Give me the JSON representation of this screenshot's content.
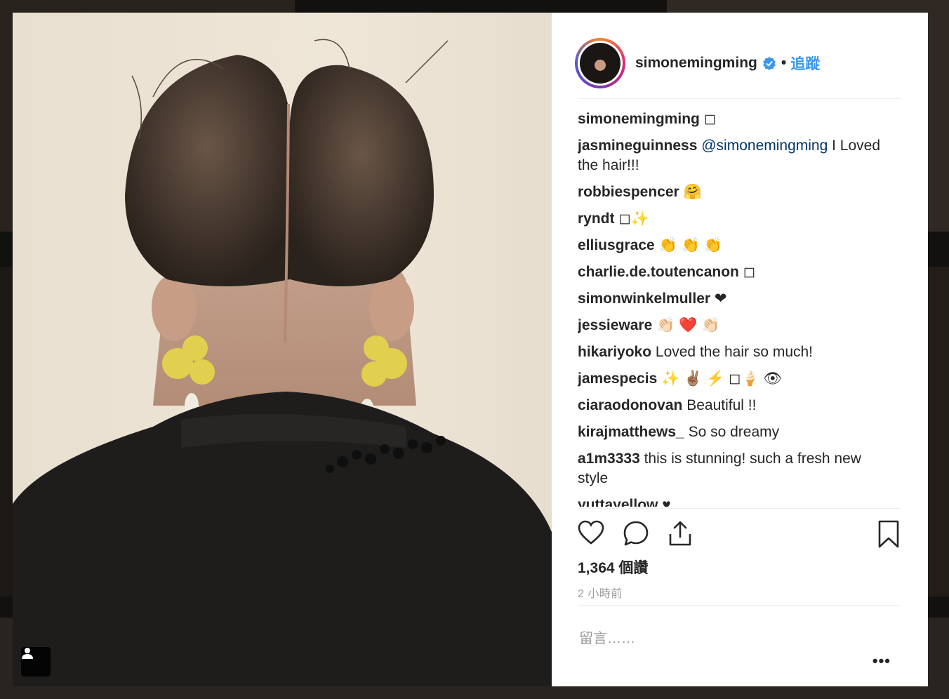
{
  "post": {
    "username": "simonemingming",
    "dot": "•",
    "follow_label": "追蹤",
    "caption_symbol": "◻"
  },
  "comments": [
    {
      "user": "simonemingming",
      "text": "◻"
    },
    {
      "user": "jasmineguinness",
      "mention": "@simonemingming",
      "text": " I Loved the hair!!!"
    },
    {
      "user": "robbiespencer",
      "text": "🤗"
    },
    {
      "user": "ryndt",
      "text": "◻✨"
    },
    {
      "user": "elliusgrace",
      "text": "👏 👏 👏"
    },
    {
      "user": "charlie.de.toutencanon",
      "text": "◻"
    },
    {
      "user": "simonwinkelmuller",
      "text": "❤"
    },
    {
      "user": "jessieware",
      "text": "👏🏻 ❤️ 👏🏻"
    },
    {
      "user": "hikariyoko",
      "text": "Loved the hair so much!"
    },
    {
      "user": "jamespecis",
      "text": "✨ ✌🏽 ⚡ ◻🍦 👁"
    },
    {
      "user": "ciaraodonovan",
      "text": "Beautiful !!"
    },
    {
      "user": "kirajmatthews_",
      "text": "So so dreamy"
    },
    {
      "user": "a1m3333",
      "text": "this is stunning! such a fresh new style"
    },
    {
      "user": "yuttayellow",
      "text": "♥"
    }
  ],
  "likes": "1,364 個讚",
  "time": "2 小時前",
  "comment_placeholder": "留言……",
  "more": "•••",
  "icons": {
    "verified": "verified-badge-icon",
    "like": "heart-icon",
    "comment": "comment-bubble-icon",
    "share": "share-icon",
    "save": "bookmark-icon",
    "tag": "user-tag-icon"
  },
  "colors": {
    "accent": "#3897f0",
    "text": "#262626",
    "muted": "#999999",
    "mention": "#003569"
  }
}
